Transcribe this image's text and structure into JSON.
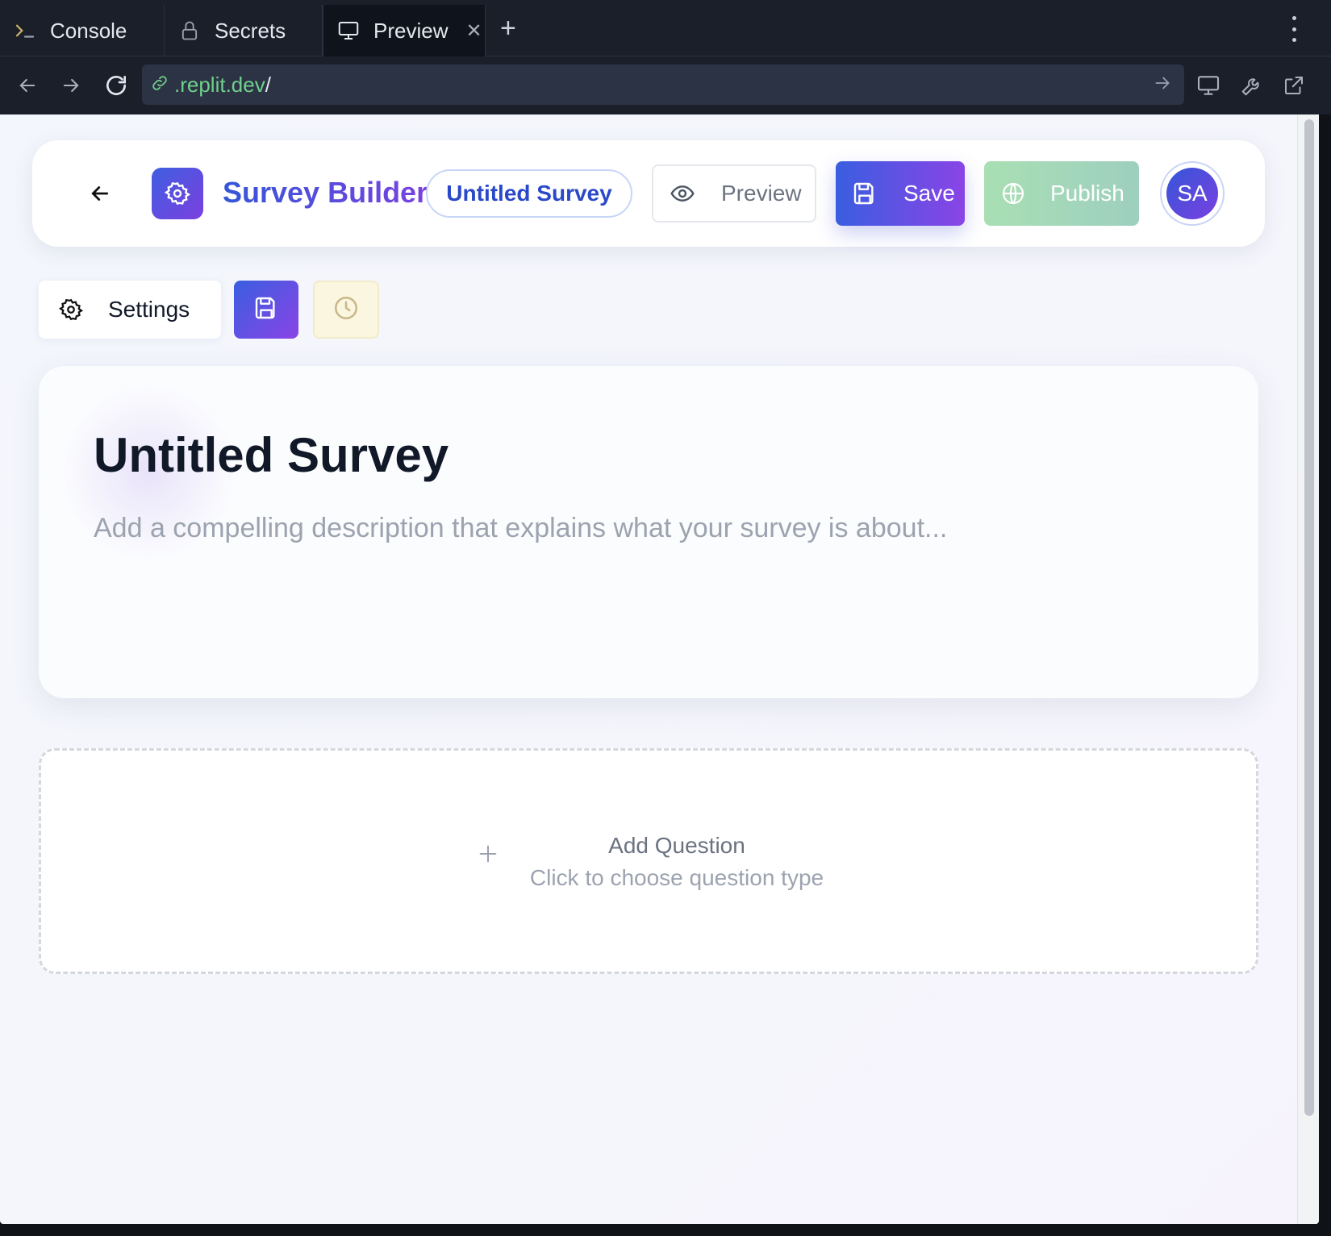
{
  "browser": {
    "tabs": [
      {
        "label": "Console",
        "icon": "terminal-icon"
      },
      {
        "label": "Secrets",
        "icon": "lock-icon"
      },
      {
        "label": "Preview",
        "icon": "monitor-icon",
        "active": true
      }
    ],
    "url": {
      "host": ".replit.dev",
      "path": "/"
    }
  },
  "header": {
    "brand": "Survey Builder",
    "survey_pill": "Untitled Survey",
    "preview_label": "Preview",
    "save_label": "Save",
    "publish_label": "Publish",
    "avatar_initials": "SA"
  },
  "toolbar": {
    "settings_label": "Settings"
  },
  "survey": {
    "title": "Untitled Survey",
    "description_placeholder": "Add a compelling description that explains what your survey is about..."
  },
  "add_question": {
    "title": "Add Question",
    "subtitle": "Click to choose question type"
  },
  "colors": {
    "brand_gradient_start": "#3a5ee0",
    "brand_gradient_end": "#8a44e6",
    "publish_green": "#a9dfb3",
    "url_green": "#6fd08c"
  }
}
